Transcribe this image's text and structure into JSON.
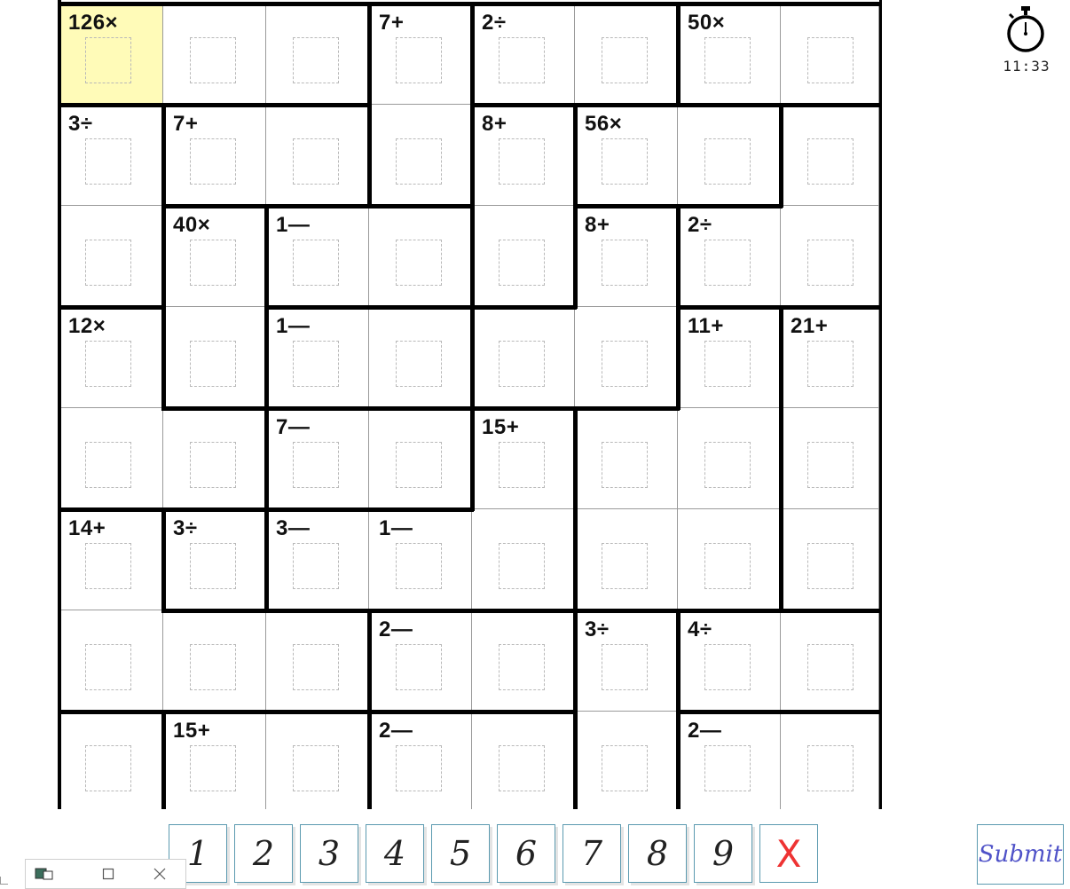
{
  "puzzle": {
    "size": 8,
    "selected": [
      0,
      0
    ],
    "clues": [
      {
        "r": 0,
        "c": 0,
        "text": "126×"
      },
      {
        "r": 0,
        "c": 3,
        "text": "7+"
      },
      {
        "r": 0,
        "c": 4,
        "text": "2÷"
      },
      {
        "r": 0,
        "c": 6,
        "text": "50×"
      },
      {
        "r": 1,
        "c": 0,
        "text": "3÷"
      },
      {
        "r": 1,
        "c": 1,
        "text": "7+"
      },
      {
        "r": 1,
        "c": 4,
        "text": "8+"
      },
      {
        "r": 1,
        "c": 5,
        "text": "56×"
      },
      {
        "r": 2,
        "c": 1,
        "text": "40×"
      },
      {
        "r": 2,
        "c": 2,
        "text": "1—"
      },
      {
        "r": 2,
        "c": 5,
        "text": "8+"
      },
      {
        "r": 2,
        "c": 6,
        "text": "2÷"
      },
      {
        "r": 3,
        "c": 0,
        "text": "12×"
      },
      {
        "r": 3,
        "c": 2,
        "text": "1—"
      },
      {
        "r": 3,
        "c": 6,
        "text": "11+"
      },
      {
        "r": 3,
        "c": 7,
        "text": "21+"
      },
      {
        "r": 4,
        "c": 2,
        "text": "7—"
      },
      {
        "r": 4,
        "c": 4,
        "text": "15+"
      },
      {
        "r": 5,
        "c": 0,
        "text": "14+"
      },
      {
        "r": 5,
        "c": 1,
        "text": "3÷"
      },
      {
        "r": 5,
        "c": 2,
        "text": "3—"
      },
      {
        "r": 5,
        "c": 3,
        "text": "1—"
      },
      {
        "r": 6,
        "c": 3,
        "text": "2—"
      },
      {
        "r": 6,
        "c": 5,
        "text": "3÷"
      },
      {
        "r": 6,
        "c": 6,
        "text": "4÷"
      },
      {
        "r": 7,
        "c": 1,
        "text": "15+"
      },
      {
        "r": 7,
        "c": 3,
        "text": "2—"
      },
      {
        "r": 7,
        "c": 6,
        "text": "2—"
      }
    ],
    "cages": [
      [
        [
          0,
          0
        ],
        [
          0,
          1
        ],
        [
          0,
          2
        ]
      ],
      [
        [
          0,
          3
        ],
        [
          1,
          3
        ]
      ],
      [
        [
          0,
          4
        ],
        [
          0,
          5
        ]
      ],
      [
        [
          0,
          6
        ],
        [
          0,
          7
        ]
      ],
      [
        [
          1,
          0
        ],
        [
          2,
          0
        ]
      ],
      [
        [
          1,
          1
        ],
        [
          1,
          2
        ]
      ],
      [
        [
          1,
          4
        ],
        [
          2,
          4
        ]
      ],
      [
        [
          1,
          5
        ],
        [
          1,
          6
        ]
      ],
      [
        [
          1,
          7
        ],
        [
          2,
          7
        ]
      ],
      [
        [
          2,
          1
        ],
        [
          3,
          1
        ]
      ],
      [
        [
          2,
          2
        ],
        [
          2,
          3
        ]
      ],
      [
        [
          2,
          5
        ],
        [
          3,
          5
        ],
        [
          3,
          4
        ]
      ],
      [
        [
          2,
          6
        ],
        [
          2,
          7
        ]
      ],
      [
        [
          3,
          0
        ],
        [
          4,
          0
        ],
        [
          4,
          1
        ]
      ],
      [
        [
          3,
          2
        ],
        [
          3,
          3
        ]
      ],
      [
        [
          3,
          6
        ],
        [
          4,
          6
        ],
        [
          4,
          5
        ],
        [
          5,
          5
        ],
        [
          5,
          6
        ]
      ],
      [
        [
          3,
          7
        ],
        [
          4,
          7
        ],
        [
          5,
          7
        ]
      ],
      [
        [
          4,
          2
        ],
        [
          4,
          3
        ]
      ],
      [
        [
          4,
          4
        ],
        [
          5,
          4
        ]
      ],
      [
        [
          5,
          0
        ],
        [
          6,
          0
        ],
        [
          6,
          1
        ],
        [
          6,
          2
        ]
      ],
      [
        [
          5,
          1
        ]
      ],
      [
        [
          5,
          2
        ],
        [
          5,
          3
        ]
      ],
      [
        [
          5,
          3
        ],
        [
          5,
          4
        ]
      ],
      [
        [
          6,
          3
        ],
        [
          6,
          4
        ]
      ],
      [
        [
          6,
          5
        ],
        [
          7,
          5
        ]
      ],
      [
        [
          6,
          6
        ],
        [
          6,
          7
        ]
      ],
      [
        [
          7,
          0
        ]
      ],
      [
        [
          7,
          1
        ],
        [
          7,
          2
        ]
      ],
      [
        [
          7,
          3
        ],
        [
          7,
          4
        ]
      ],
      [
        [
          7,
          6
        ],
        [
          7,
          7
        ]
      ]
    ]
  },
  "timer": {
    "icon": "stopwatch-icon",
    "time": "11:33"
  },
  "numpad": {
    "keys": [
      "1",
      "2",
      "3",
      "4",
      "5",
      "6",
      "7",
      "8",
      "9"
    ],
    "clear_icon": "clear-x-icon",
    "clear_label": "X"
  },
  "submit_label": "Submit",
  "taskbar": {
    "icons": [
      "switch-window-icon",
      "maximize-icon",
      "close-icon"
    ]
  },
  "colors": {
    "selected_cell": "#fffbb8",
    "key_border": "#5b9ab0",
    "submit_text": "#4f52c8",
    "clear": "#ee3333"
  }
}
